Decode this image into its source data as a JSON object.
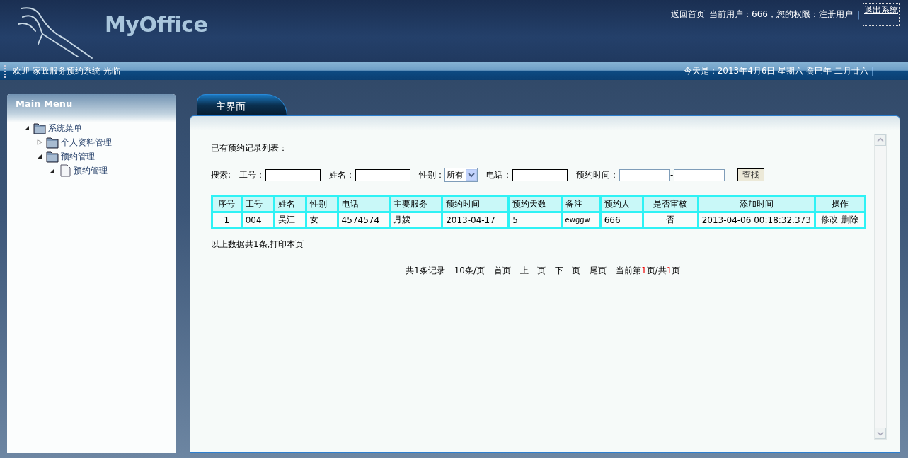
{
  "header": {
    "logo": "MyOffice",
    "links": [
      {
        "kind": "link",
        "text": "返回首页"
      },
      {
        "kind": "text",
        "text": "当前用户：666，您的权限：注册用户"
      },
      {
        "kind": "sep",
        "text": "|"
      },
      {
        "kind": "link",
        "text": "退出系统",
        "focused": true
      }
    ]
  },
  "welcome_bar": {
    "welcome": "欢迎 家政服务预约系统 光临",
    "date": "今天是：2013年4月6日 星期六 癸巳年 二月廿六",
    "separator": "|"
  },
  "sidebar": {
    "title": "Main Menu",
    "tree": [
      {
        "label": "系统菜单",
        "kind": "folder",
        "expanded": true,
        "children": [
          {
            "label": "个人资料管理",
            "kind": "folder",
            "expanded": false
          },
          {
            "label": "预约管理",
            "kind": "folder",
            "expanded": true,
            "children": [
              {
                "label": "预约管理",
                "kind": "file",
                "expanded": true
              }
            ]
          }
        ]
      }
    ]
  },
  "tabs": [
    {
      "label": "主界面",
      "selected": true
    }
  ],
  "content": {
    "heading": "已有预约记录列表：",
    "search": {
      "label": "搜索:",
      "fields": [
        {
          "label": "工号：",
          "kind": "text"
        },
        {
          "label": "姓名：",
          "kind": "text"
        },
        {
          "label": "性别：",
          "kind": "select",
          "value": "所有"
        },
        {
          "label": "电话：",
          "kind": "text"
        },
        {
          "label": "预约时间：",
          "kind": "range",
          "separator": "-"
        }
      ],
      "button": "查找"
    },
    "table": {
      "columns": [
        "序号",
        "工号",
        "姓名",
        "性别",
        "电话",
        "主要服务",
        "预约时间",
        "预约天数",
        "备注",
        "预约人",
        "是否审核",
        "添加时间",
        "操作"
      ],
      "rows": [
        {
          "cells": [
            "1",
            "004",
            "吴江",
            "女",
            "4574574",
            "月嫂",
            "2013-04-17",
            "5",
            "ewggw",
            "666",
            "否",
            "2013-04-06 00:18:32.373"
          ],
          "actions": [
            "修改",
            "删除"
          ]
        }
      ]
    },
    "summary": "以上数据共1条,打印本页",
    "pager": {
      "items": [
        "共1条记录",
        "10条/页",
        "首页",
        "上一页",
        "下一页",
        "尾页"
      ],
      "status": {
        "prefix": "当前第",
        "current": "1",
        "middle": "页/共",
        "total": "1",
        "suffix": "页"
      }
    }
  }
}
